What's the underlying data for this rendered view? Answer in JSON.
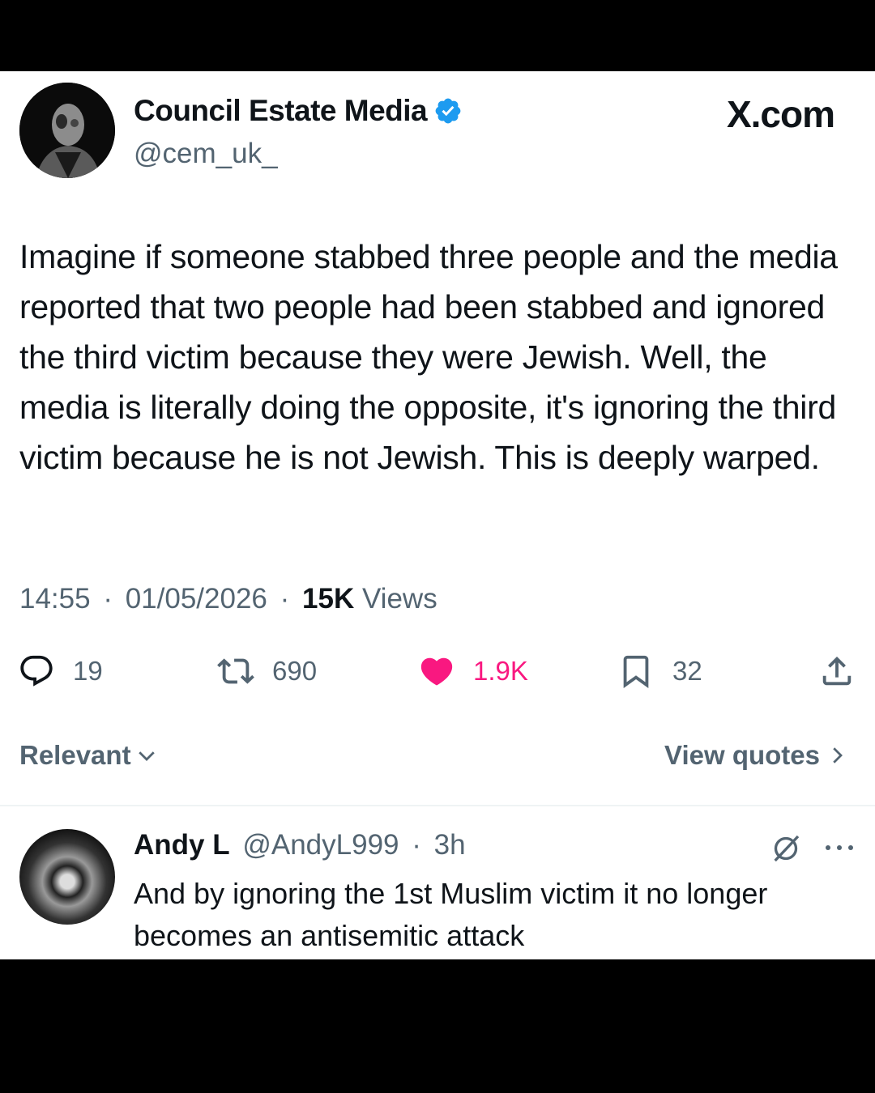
{
  "site": {
    "label": "X.com"
  },
  "post": {
    "author_name": "Council Estate Media",
    "author_handle": "@cem_uk_",
    "text": "Imagine if someone stabbed three people and the media reported that two people had been stabbed and ignored the third victim because they were Jewish. Well, the media is literally doing the opposite, it's ignoring the third victim because he is not Jewish. This is deeply warped.",
    "time": "14:55",
    "date": "01/05/2026",
    "views_count": "15K",
    "views_label": "Views",
    "separator": "·"
  },
  "actions": {
    "replies": "19",
    "reposts": "690",
    "likes": "1.9K",
    "bookmarks": "32"
  },
  "replies_bar": {
    "sort_label": "Relevant",
    "quotes_label": "View quotes"
  },
  "reply": {
    "name": "Andy L",
    "handle": "@AndyL999",
    "separator": "·",
    "time": "3h",
    "text": "And by ignoring the 1st Muslim victim it no longer becomes an antisemitic attack"
  },
  "colors": {
    "like_pink": "#f91880",
    "verified_blue": "#1d9bf0",
    "muted_text": "#536471"
  },
  "icons": [
    "verified-badge-icon",
    "reply-icon",
    "repost-icon",
    "heart-icon",
    "bookmark-icon",
    "share-icon",
    "chevron-down-icon",
    "chevron-right-icon",
    "grok-icon",
    "more-icon"
  ]
}
